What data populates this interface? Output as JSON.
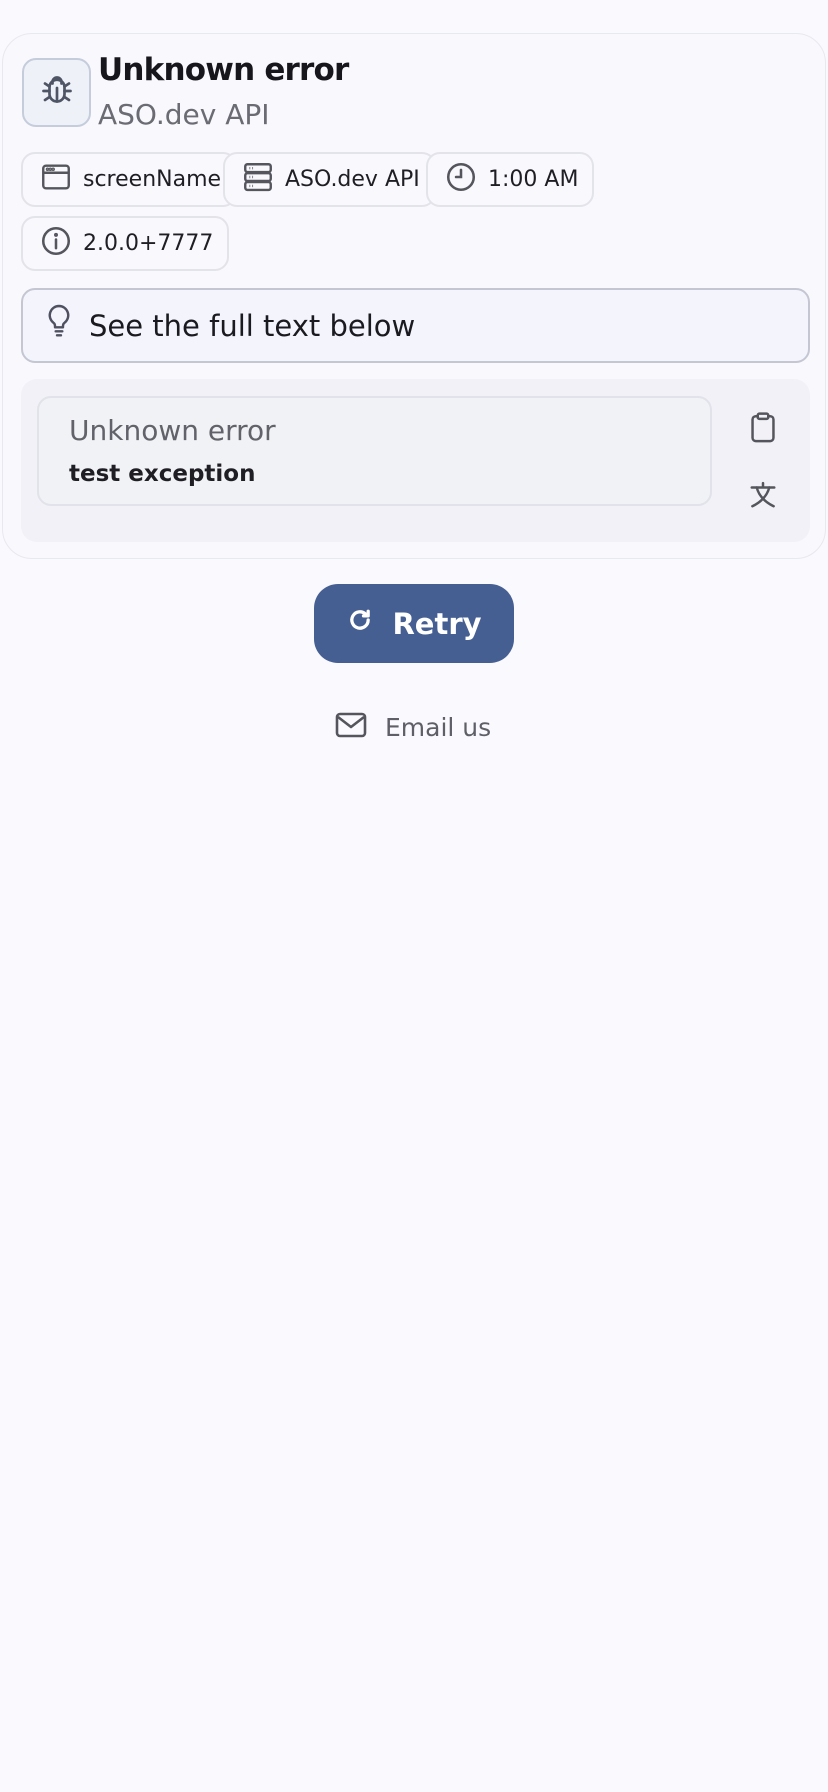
{
  "error": {
    "title": "Unknown error",
    "source": "ASO.dev API",
    "icon": "bug-icon"
  },
  "chips": {
    "screen": {
      "label": "screenName",
      "icon": "window-icon"
    },
    "service": {
      "label": "ASO.dev API",
      "icon": "server-icon"
    },
    "time": {
      "label": "1:00 AM",
      "icon": "clock-icon"
    },
    "version": {
      "label": "2.0.0+7777",
      "icon": "info-icon"
    }
  },
  "hint": {
    "text": "See the full text below",
    "icon": "lightbulb-icon"
  },
  "details": {
    "title": "Unknown error",
    "message": "test exception",
    "copy_icon": "clipboard-icon",
    "translate_icon": "translate-icon"
  },
  "actions": {
    "retry_label": "Retry",
    "email_label": "Email us"
  },
  "colors": {
    "background": "#f9f9fe",
    "primary": "#465f92",
    "muted_text": "#6b6b73"
  }
}
